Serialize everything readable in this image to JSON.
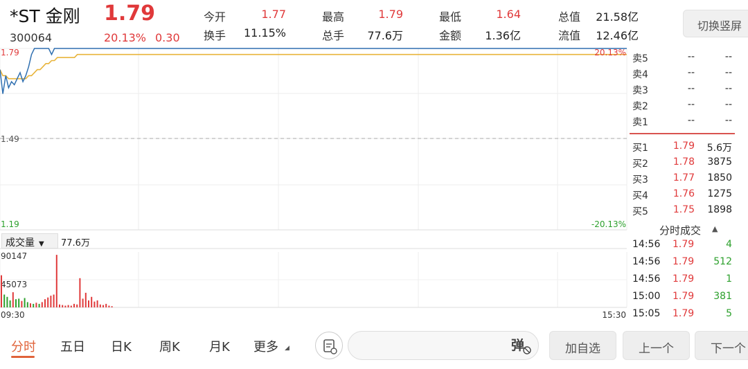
{
  "header": {
    "name": "*ST 金刚",
    "code": "300064",
    "price": "1.79",
    "change_pct": "20.13%",
    "change": "0.30",
    "switch_label": "切换竖屏"
  },
  "quote": [
    {
      "label": "今开",
      "value": "1.77",
      "color": "red"
    },
    {
      "label": "最高",
      "value": "1.79",
      "color": "red"
    },
    {
      "label": "最低",
      "value": "1.64",
      "color": "red"
    },
    {
      "label": "总值",
      "value": "21.58亿",
      "color": "black"
    },
    {
      "label": "换手",
      "value": "11.15%",
      "color": "black"
    },
    {
      "label": "总手",
      "value": "77.6万",
      "color": "black"
    },
    {
      "label": "金额",
      "value": "1.36亿",
      "color": "black"
    },
    {
      "label": "流值",
      "value": "12.46亿",
      "color": "black"
    }
  ],
  "chart": {
    "price_high": "1.79",
    "price_mid": "1.49",
    "price_low": "1.19",
    "pct_high": "20.13%",
    "pct_low": "-20.13%",
    "time_start": "09:30",
    "time_end": "15:30",
    "vol_max": "90147",
    "vol_mid": "45073",
    "colors": {
      "price": "#2f6fb0",
      "avg": "#e8b43a",
      "up": "#e0393a",
      "down": "#2ca02c"
    }
  },
  "chart_data": {
    "type": "line",
    "series": [
      {
        "values": [
          1.72,
          1.64,
          1.7,
          1.66,
          1.68,
          1.67,
          1.69,
          1.71,
          1.68,
          1.7,
          1.73,
          1.77,
          1.79,
          1.79,
          1.79,
          1.79,
          1.79,
          1.79,
          1.77,
          1.79,
          1.79,
          1.79,
          1.79,
          1.79,
          1.79,
          1.79,
          1.79,
          1.79,
          1.79,
          1.79
        ]
      },
      {
        "values": [
          1.72,
          1.7,
          1.7,
          1.69,
          1.69,
          1.69,
          1.69,
          1.69,
          1.69,
          1.69,
          1.7,
          1.7,
          1.71,
          1.72,
          1.72,
          1.73,
          1.74,
          1.74,
          1.75,
          1.75,
          1.76,
          1.76,
          1.76,
          1.76,
          1.76,
          1.76,
          1.76,
          1.77,
          1.77,
          1.77
        ]
      }
    ],
    "ylim": [
      1.19,
      1.79
    ],
    "volume": [
      {
        "v": 55000,
        "up": true
      },
      {
        "v": 22000,
        "up": false
      },
      {
        "v": 18000,
        "up": false
      },
      {
        "v": 12000,
        "up": false
      },
      {
        "v": 26000,
        "up": true
      },
      {
        "v": 14000,
        "up": false
      },
      {
        "v": 15000,
        "up": false
      },
      {
        "v": 11000,
        "up": true
      },
      {
        "v": 16000,
        "up": false
      },
      {
        "v": 9000,
        "up": false
      },
      {
        "v": 7000,
        "up": true
      },
      {
        "v": 6000,
        "up": false
      },
      {
        "v": 8000,
        "up": true
      },
      {
        "v": 6000,
        "up": false
      },
      {
        "v": 9000,
        "up": true
      },
      {
        "v": 14000,
        "up": true
      },
      {
        "v": 17000,
        "up": true
      },
      {
        "v": 20000,
        "up": true
      },
      {
        "v": 22000,
        "up": true
      },
      {
        "v": 90000,
        "up": true
      },
      {
        "v": 5000,
        "up": true
      },
      {
        "v": 4000,
        "up": true
      },
      {
        "v": 3000,
        "up": true
      },
      {
        "v": 4000,
        "up": true
      },
      {
        "v": 3000,
        "up": true
      },
      {
        "v": 6000,
        "up": true
      },
      {
        "v": 5000,
        "up": true
      },
      {
        "v": 50000,
        "up": true
      },
      {
        "v": 15000,
        "up": true
      },
      {
        "v": 25000,
        "up": true
      },
      {
        "v": 12000,
        "up": true
      },
      {
        "v": 18000,
        "up": true
      },
      {
        "v": 10000,
        "up": true
      },
      {
        "v": 12000,
        "up": true
      },
      {
        "v": 5000,
        "up": true
      },
      {
        "v": 4000,
        "up": true
      },
      {
        "v": 6000,
        "up": true
      },
      {
        "v": 3000,
        "up": true
      },
      {
        "v": 2000,
        "up": true
      }
    ]
  },
  "order_book": {
    "sell": [
      {
        "label": "卖5",
        "price": "--",
        "vol": "--"
      },
      {
        "label": "卖4",
        "price": "--",
        "vol": "--"
      },
      {
        "label": "卖3",
        "price": "--",
        "vol": "--"
      },
      {
        "label": "卖2",
        "price": "--",
        "vol": "--"
      },
      {
        "label": "卖1",
        "price": "--",
        "vol": "--"
      }
    ],
    "buy": [
      {
        "label": "买1",
        "price": "1.79",
        "vol": "5.6万"
      },
      {
        "label": "买2",
        "price": "1.78",
        "vol": "3875"
      },
      {
        "label": "买3",
        "price": "1.77",
        "vol": "1850"
      },
      {
        "label": "买4",
        "price": "1.76",
        "vol": "1275"
      },
      {
        "label": "买5",
        "price": "1.75",
        "vol": "1898"
      }
    ]
  },
  "ticks": {
    "title": "分时成交",
    "caret": "▲",
    "rows": [
      {
        "time": "14:56",
        "price": "1.79",
        "vol": "4"
      },
      {
        "time": "14:56",
        "price": "1.79",
        "vol": "512"
      },
      {
        "time": "14:56",
        "price": "1.79",
        "vol": "1"
      },
      {
        "time": "15:00",
        "price": "1.79",
        "vol": "381"
      },
      {
        "time": "15:05",
        "price": "1.79",
        "vol": "5"
      }
    ]
  },
  "volume_panel": {
    "selector": "成交量",
    "caret": "▼",
    "total": "77.6万"
  },
  "tabs": [
    {
      "label": "分时",
      "active": true
    },
    {
      "label": "五日",
      "active": false
    },
    {
      "label": "日K",
      "active": false
    },
    {
      "label": "周K",
      "active": false
    },
    {
      "label": "月K",
      "active": false
    },
    {
      "label": "更多",
      "active": false
    }
  ],
  "bottom": {
    "danmu_label": "弹",
    "add_watch": "加自选",
    "prev": "上一个",
    "next": "下一个"
  }
}
